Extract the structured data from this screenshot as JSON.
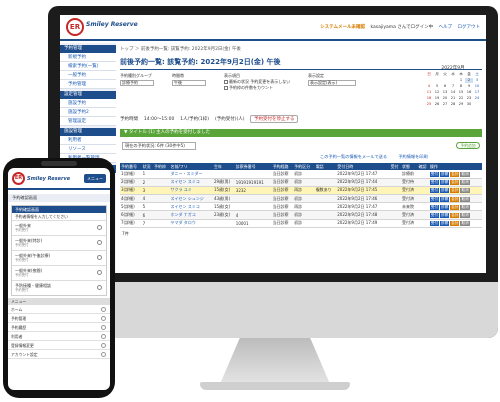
{
  "header": {
    "logo_mark": "ER",
    "logo_text": "Smiley Reserve",
    "warning": "システムメール未確認",
    "user": "kasajiyama さんでログイン中",
    "help": "ヘルプ",
    "logout": "ログアウト"
  },
  "sidebar": {
    "sections": [
      {
        "title": "予約管理",
        "items": [
          "新規予約",
          "検索予約(一覧)",
          "一般予約",
          "予約管理"
        ]
      },
      {
        "title": "設定管理",
        "items": [
          "施設予約",
          "施設予約2",
          "管理設定"
        ]
      },
      {
        "title": "施設管理",
        "items": [
          "利用者",
          "リソース",
          "利用者一覧管理"
        ]
      },
      {
        "title": "施設設定",
        "items": []
      }
    ]
  },
  "main": {
    "breadcrumb": "トップ ＞ 前後予約一覧: 該覧予約: 2022年9月2日(金) 午後",
    "title": "前後予約一覧: 該覧予約: 2022年9月2日(金) 午後",
    "filters": {
      "group_label": "予約種別グループ",
      "group_value": "診療予約",
      "type_label": "時間帯",
      "type_value": "午後",
      "display_label": "表示項目",
      "display_opt1": "最新の状況 予約変更を表示しない",
      "display_opt2": "予約枠の件数をカウント",
      "option_label": "表示設定",
      "option_value": "表示設定(表示)"
    },
    "calendar": {
      "header": "2022年9月",
      "days": [
        "日",
        "月",
        "火",
        "水",
        "木",
        "金",
        "土"
      ],
      "dates": [
        "",
        "",
        "",
        "",
        "1",
        "2",
        "3",
        "4",
        "5",
        "6",
        "7",
        "8",
        "9",
        "10",
        "11",
        "12",
        "13",
        "14",
        "15",
        "16",
        "17",
        "18",
        "19",
        "20",
        "21",
        "22",
        "23",
        "24",
        "25",
        "26",
        "27",
        "28",
        "29",
        "30",
        ""
      ]
    },
    "time_row": "予約時間 　14:00～15:00 　1人/予約(1枠) 　(予約受付)(人)",
    "time_button": "予約受付を停止する",
    "green_bar": "▼ タイトル (1) 主人の予約を受付しました",
    "info": "現在の予約状況: 6件 (30件中5)",
    "info_button": "予約追加",
    "links": [
      "この予約一覧の情報をメールで送る",
      "予約情報を印刷"
    ],
    "columns": [
      "予約番号",
      "状況",
      "予約枠",
      "名前/フリ",
      "生年",
      "診察券番号",
      "予約経路",
      "予約区分",
      "電話",
      "受付日時",
      "",
      "受付",
      "状態",
      "確認",
      "操作"
    ],
    "rows": [
      {
        "no": "1(詳細)",
        "q": "1",
        "name": "ダニー・スミダー",
        "birth": "",
        "card": "",
        "route": "当日診察",
        "cat": "初診",
        "tel": "",
        "date": "2022年9月2日 17:47",
        "rec": "",
        "stat": "診療前",
        "hl": false
      },
      {
        "no": "2(詳細)",
        "q": "2",
        "name": "スイセン スミコ",
        "birth": "29歳(男)",
        "card": "19191919191",
        "route": "当日診察",
        "cat": "初診",
        "tel": "",
        "date": "2022年9月2日 17:44",
        "rec": "",
        "stat": "受付待",
        "hl": false
      },
      {
        "no": "3(詳細)",
        "q": "3",
        "name": "サクラ ユミ",
        "birth": "15歳(女)",
        "card": "3232",
        "route": "当日診察",
        "cat": "再診",
        "tel": "複数あり",
        "date": "2022年9月2日 17:45",
        "rec": "",
        "stat": "受付済",
        "hl": true
      },
      {
        "no": "4(詳細)",
        "q": "4",
        "name": "スイセン シュンジ",
        "birth": "43歳(男)",
        "card": "",
        "route": "当日診察",
        "cat": "初診",
        "tel": "",
        "date": "2022年9月2日 17:46",
        "rec": "",
        "stat": "受付済",
        "hl": false
      },
      {
        "no": "5(詳細)",
        "q": "5",
        "name": "スイセン スミコ",
        "birth": "15歳(女)",
        "card": "",
        "route": "当日診察",
        "cat": "再診",
        "tel": "",
        "date": "2022年9月2日 17:47",
        "rec": "",
        "stat": "未来院",
        "hl": false
      },
      {
        "no": "6(詳細)",
        "q": "6",
        "name": "ホンダ ナガコ",
        "birth": "23歳(女)",
        "card": "4",
        "route": "当日診察",
        "cat": "初診",
        "tel": "",
        "date": "2022年9月2日 17:48",
        "rec": "",
        "stat": "受付済",
        "hl": false
      },
      {
        "no": "7(詳細)",
        "q": "7",
        "name": "ヤマダ タロウ",
        "birth": "",
        "card": "10001",
        "route": "当日診察",
        "cat": "初診",
        "tel": "",
        "date": "2022年9月2日 17:49",
        "rec": "",
        "stat": "受付済",
        "hl": false
      }
    ],
    "tags": [
      "受付",
      "診察",
      "会計",
      "取消"
    ],
    "count": "7件"
  },
  "phone": {
    "logo_mark": "ER",
    "logo_text": "Smiley Reserve",
    "menu_label": "メニュー",
    "band": "予約確認画面",
    "sec_title": "予約確認画面",
    "sec_text": "予約者情報を入力してください",
    "items": [
      {
        "title": "一般外来",
        "sub": "予約受付"
      },
      {
        "title": "一般外来(特診)",
        "sub": "予約受付"
      },
      {
        "title": "一般外来(午後診療)",
        "sub": "予約受付"
      },
      {
        "title": "一般外来(夜間)",
        "sub": "予約受付"
      },
      {
        "title": "予防接種・健康相談",
        "sub": "予約受付"
      }
    ],
    "menu_header": "メニュー",
    "menu_items": [
      "ホーム",
      "予約管理",
      "予約履歴",
      "利用者",
      "登録情報変更",
      "アカウント設定"
    ]
  }
}
